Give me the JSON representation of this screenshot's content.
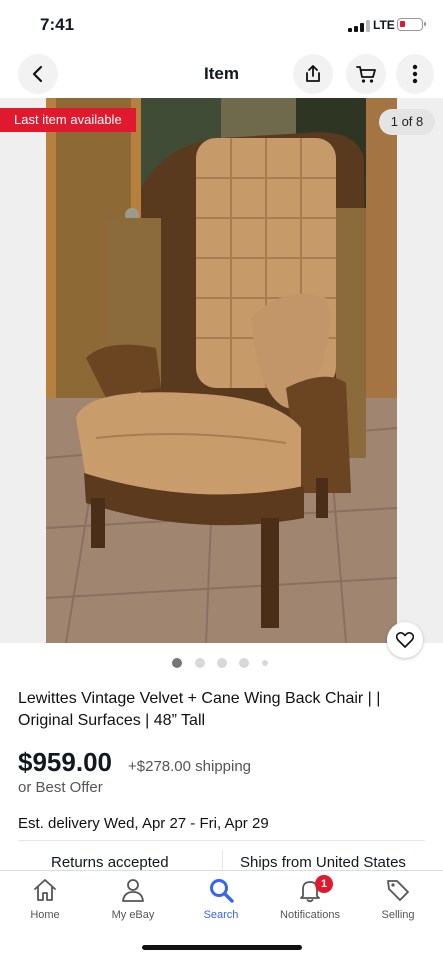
{
  "status": {
    "time": "7:41",
    "network": "LTE"
  },
  "header": {
    "title": "Item"
  },
  "gallery": {
    "badge": "Last item available",
    "counter": "1 of 8",
    "photo_description_icon": "chair-photo",
    "dots_count": 5,
    "active_dot": 0
  },
  "item": {
    "title": "Lewittes Vintage Velvet + Cane Wing Back Chair | | Original Surfaces | 48” Tall",
    "price": "$959.00",
    "shipping": "+$278.00 shipping",
    "best_offer": "or Best Offer",
    "delivery": "Est. delivery Wed, Apr 27 - Fri, Apr 29",
    "returns": "Returns accepted",
    "ships_from": "Ships from United States"
  },
  "nav": {
    "items": [
      {
        "label": "Home",
        "icon": "home-icon"
      },
      {
        "label": "My eBay",
        "icon": "person-icon"
      },
      {
        "label": "Search",
        "icon": "search-icon"
      },
      {
        "label": "Notifications",
        "icon": "bell-icon",
        "badge": "1"
      },
      {
        "label": "Selling",
        "icon": "tag-icon"
      }
    ],
    "active": "Search"
  },
  "colors": {
    "accent": "#3665f3",
    "badge_red": "#e0192e"
  }
}
